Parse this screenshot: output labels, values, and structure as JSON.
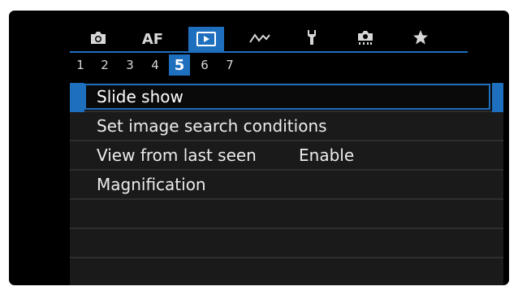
{
  "tabs": [
    {
      "id": "shooting",
      "icon": "camera-icon"
    },
    {
      "id": "af",
      "label": "AF"
    },
    {
      "id": "playback",
      "icon": "play-icon",
      "active": true
    },
    {
      "id": "custom",
      "icon": "wave-icon"
    },
    {
      "id": "setup",
      "icon": "wrench-icon"
    },
    {
      "id": "function",
      "icon": "camera-settings-icon"
    },
    {
      "id": "mymenu",
      "icon": "star-icon"
    }
  ],
  "pages": [
    "1",
    "2",
    "3",
    "4",
    "5",
    "6",
    "7"
  ],
  "active_page": "5",
  "menu": {
    "items": [
      {
        "label": "Slide show",
        "value": ""
      },
      {
        "label": "Set image search conditions",
        "value": ""
      },
      {
        "label": "View from last seen",
        "value": "Enable"
      },
      {
        "label": "Magnification",
        "value": ""
      }
    ],
    "empty_rows": 3
  },
  "colors": {
    "accent": "#1f6fbf",
    "background": "#000000",
    "row": "#1a1a1a",
    "text": "#ececec"
  }
}
